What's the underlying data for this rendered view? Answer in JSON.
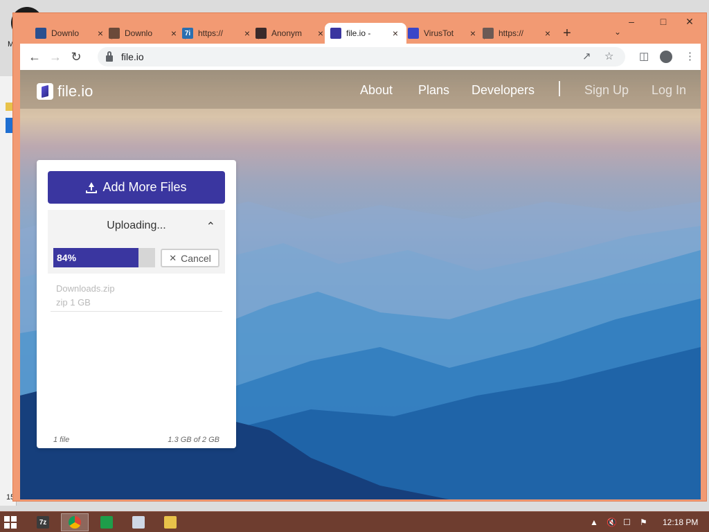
{
  "desktop": {
    "stray_label": "M",
    "stray_number": "15"
  },
  "tabs": [
    {
      "title": "Downlo",
      "icon": "download-page-icon",
      "active": false
    },
    {
      "title": "Downlo",
      "icon": "download-arrow-icon",
      "active": false
    },
    {
      "title": "https://",
      "icon": "7zip-icon",
      "icon_text": "7i",
      "active": false
    },
    {
      "title": "Anonym",
      "icon": "anonymous-icon",
      "active": false
    },
    {
      "title": "file.io - ",
      "icon": "fileio-icon",
      "active": true
    },
    {
      "title": "VirusTot",
      "icon": "virustotal-icon",
      "active": false
    },
    {
      "title": "https://",
      "icon": "globe-icon",
      "active": false
    }
  ],
  "browser": {
    "url": "file.io",
    "new_tab_symbol": "+",
    "tab_menu_symbol": "⌄"
  },
  "site": {
    "logo_text": "file.io",
    "nav": [
      "About",
      "Plans",
      "Developers"
    ],
    "auth": [
      "Sign Up",
      "Log In"
    ]
  },
  "uploader": {
    "add_button": "Add More Files",
    "status": "Uploading...",
    "progress_percent": 84,
    "progress_label": "84%",
    "cancel_label": "Cancel",
    "file_name": "Downloads.zip",
    "file_meta": "zip 1 GB",
    "file_count": "1 file",
    "usage": "1.3 GB of 2 GB"
  },
  "taskbar": {
    "apps": [
      {
        "name": "7zip-taskbar-icon",
        "label": "7z"
      },
      {
        "name": "chrome-taskbar-icon",
        "label": ""
      },
      {
        "name": "shield-app-taskbar-icon",
        "label": ""
      },
      {
        "name": "notepad-taskbar-icon",
        "label": ""
      },
      {
        "name": "file-explorer-taskbar-icon",
        "label": ""
      }
    ],
    "time": "12:18 PM"
  },
  "colors": {
    "accent": "#3a36a0",
    "window_frame": "#f29a73",
    "taskbar": "#6e3d2f"
  }
}
